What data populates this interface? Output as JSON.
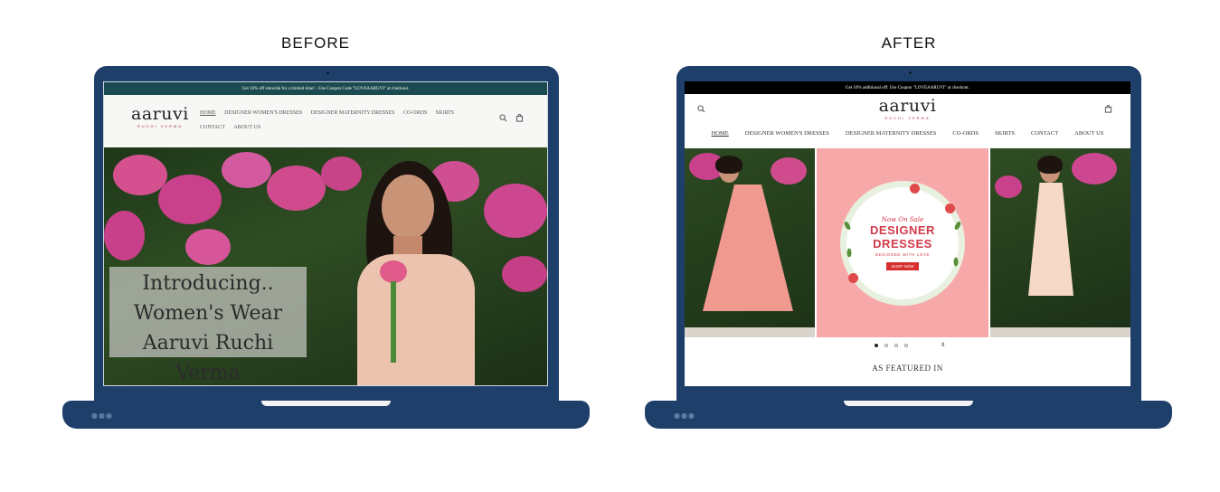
{
  "labels": {
    "before": "BEFORE",
    "after": "AFTER"
  },
  "before": {
    "promo": "Get 10% off sitewide for a limited time! - Use Coupon Code \"LOVEAARUVI\" at checkout.",
    "logo": {
      "main": "aaruvi",
      "sub": "RUCHI VERMA"
    },
    "nav": [
      "HOME",
      "DESIGNER WOMEN'S DRESSES",
      "DESIGNER MATERNITY DRESSES",
      "CO-ORDS",
      "SKIRTS",
      "CONTACT",
      "ABOUT US"
    ],
    "icons": [
      "search-icon",
      "cart-icon"
    ],
    "hero": {
      "line1": "Introducing..",
      "line2": "Women's Wear",
      "line3": "Aaruvi Ruchi Verma"
    }
  },
  "after": {
    "promo": "Get 10% additional off: Use Coupon \"LOVEAARUVI\" at checkout.",
    "logo": {
      "main": "aaruvi",
      "sub": "RUCHI VERMA"
    },
    "nav": [
      "HOME",
      "DESIGNER WOMEN'S DRESSES",
      "DESIGNER MATERNITY DRESSES",
      "CO-ORDS",
      "SKIRTS",
      "CONTACT",
      "ABOUT US"
    ],
    "banner": {
      "small": "Now On Sale",
      "big1": "DESIGNER",
      "big2": "DRESSES",
      "tag": "DESIGNED WITH LOVE",
      "button": "SHOP NOW"
    },
    "slides": {
      "count": 4,
      "active": 1,
      "pause": "II"
    },
    "featured": "AS FEATURED IN"
  },
  "colors": {
    "laptop": "#1f3f6b",
    "before_promo": "#1b4a50",
    "after_promo": "#000000",
    "accent": "#d13a4b",
    "pink_card": "#f7a9a9"
  }
}
